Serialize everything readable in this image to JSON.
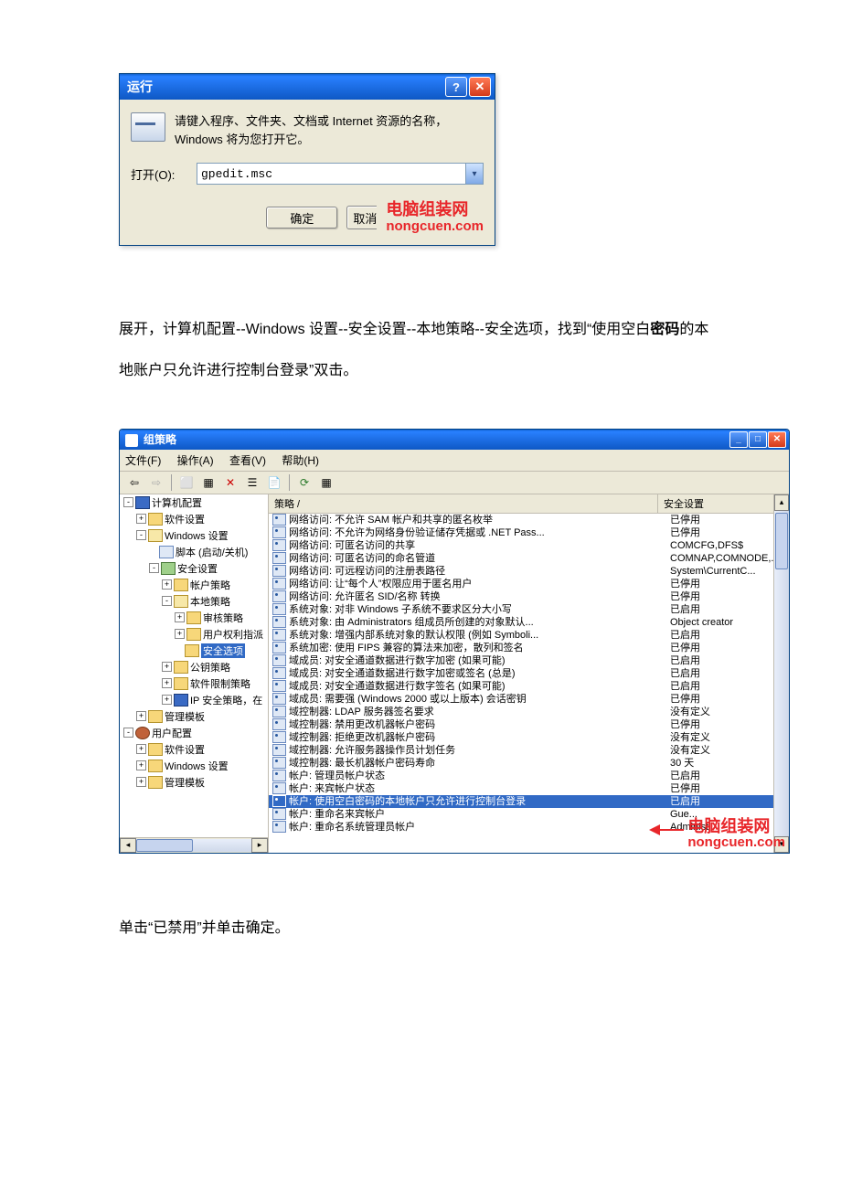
{
  "run_dialog": {
    "title": "运行",
    "description": "请键入程序、文件夹、文档或 Internet 资源的名称，Windows 将为您打开它。",
    "open_label": "打开(O):",
    "input_value": "gpedit.msc",
    "ok": "确定",
    "cancel_prefix": "取消"
  },
  "watermark": {
    "title": "电脑组装网",
    "url": "nongcuen.com"
  },
  "doc": {
    "para1_a": "展开，计算机配置--Windows 设置--安全设置--本地策略--安全选项，找到“使用空白",
    "para1_bold": "密码",
    "para1_b": "的本地账户只允许进行控制台登录”双击。",
    "para2": "单击“已禁用”并单击确定。"
  },
  "gp": {
    "title": "组策略",
    "menu": {
      "file": "文件(F)",
      "action": "操作(A)",
      "view": "查看(V)",
      "help": "帮助(H)"
    },
    "header_policy": "策略  /",
    "header_setting": "安全设置",
    "tree": [
      {
        "depth": 0,
        "exp": "-",
        "icon": "comp",
        "label": "计算机配置"
      },
      {
        "depth": 1,
        "exp": "+",
        "icon": "folder",
        "label": "软件设置"
      },
      {
        "depth": 1,
        "exp": "-",
        "icon": "folder-open",
        "label": "Windows 设置"
      },
      {
        "depth": 2,
        "exp": " ",
        "icon": "script",
        "label": "脚本 (启动/关机)"
      },
      {
        "depth": 2,
        "exp": "-",
        "icon": "sec",
        "label": "安全设置"
      },
      {
        "depth": 3,
        "exp": "+",
        "icon": "folder",
        "label": "帐户策略"
      },
      {
        "depth": 3,
        "exp": "-",
        "icon": "folder-open",
        "label": "本地策略"
      },
      {
        "depth": 4,
        "exp": "+",
        "icon": "folder",
        "label": "审核策略"
      },
      {
        "depth": 4,
        "exp": "+",
        "icon": "folder",
        "label": "用户权利指派"
      },
      {
        "depth": 4,
        "exp": " ",
        "icon": "folder",
        "label": "安全选项",
        "sel": true
      },
      {
        "depth": 3,
        "exp": "+",
        "icon": "folder",
        "label": "公钥策略"
      },
      {
        "depth": 3,
        "exp": "+",
        "icon": "folder",
        "label": "软件限制策略"
      },
      {
        "depth": 3,
        "exp": "+",
        "icon": "comp",
        "label": "IP 安全策略，在"
      },
      {
        "depth": 1,
        "exp": "+",
        "icon": "folder",
        "label": "管理模板"
      },
      {
        "depth": 0,
        "exp": "-",
        "icon": "user",
        "label": "用户配置"
      },
      {
        "depth": 1,
        "exp": "+",
        "icon": "folder",
        "label": "软件设置"
      },
      {
        "depth": 1,
        "exp": "+",
        "icon": "folder",
        "label": "Windows 设置"
      },
      {
        "depth": 1,
        "exp": "+",
        "icon": "folder",
        "label": "管理模板"
      }
    ],
    "rows": [
      {
        "p": "网络访问: 不允许 SAM 帐户和共享的匿名枚举",
        "s": "已停用"
      },
      {
        "p": "网络访问: 不允许为网络身份验证储存凭据或 .NET Pass...",
        "s": "已停用"
      },
      {
        "p": "网络访问: 可匿名访问的共享",
        "s": "COMCFG,DFS$"
      },
      {
        "p": "网络访问: 可匿名访问的命名管道",
        "s": "COMNAP,COMNODE,..."
      },
      {
        "p": "网络访问: 可远程访问的注册表路径",
        "s": "System\\CurrentC..."
      },
      {
        "p": "网络访问: 让“每个人”权限应用于匿名用户",
        "s": "已停用"
      },
      {
        "p": "网络访问: 允许匿名 SID/名称 转换",
        "s": "已停用"
      },
      {
        "p": "系统对象: 对非 Windows 子系统不要求区分大小写",
        "s": "已启用"
      },
      {
        "p": "系统对象: 由 Administrators 组成员所创建的对象默认...",
        "s": "Object creator"
      },
      {
        "p": "系统对象: 增强内部系统对象的默认权限 (例如 Symboli...",
        "s": "已启用"
      },
      {
        "p": "系统加密: 使用 FIPS 兼容的算法来加密，散列和签名",
        "s": "已停用"
      },
      {
        "p": "域成员: 对安全通道数据进行数字加密 (如果可能)",
        "s": "已启用"
      },
      {
        "p": "域成员: 对安全通道数据进行数字加密或签名 (总是)",
        "s": "已启用"
      },
      {
        "p": "域成员: 对安全通道数据进行数字签名 (如果可能)",
        "s": "已启用"
      },
      {
        "p": "域成员: 需要强 (Windows 2000 或以上版本) 会话密钥",
        "s": "已停用"
      },
      {
        "p": "域控制器: LDAP 服务器签名要求",
        "s": "没有定义"
      },
      {
        "p": "域控制器: 禁用更改机器帐户密码",
        "s": "已停用"
      },
      {
        "p": "域控制器: 拒绝更改机器帐户密码",
        "s": "没有定义"
      },
      {
        "p": "域控制器: 允许服务器操作员计划任务",
        "s": "没有定义"
      },
      {
        "p": "域控制器: 最长机器帐户密码寿命",
        "s": "30 天"
      },
      {
        "p": "帐户: 管理员帐户状态",
        "s": "已启用"
      },
      {
        "p": "帐户: 来宾帐户状态",
        "s": "已停用"
      },
      {
        "p": "帐户: 使用空白密码的本地帐户只允许进行控制台登录",
        "s": "已启用",
        "selected": true
      },
      {
        "p": "帐户: 重命名来宾帐户",
        "s": "Gue..."
      },
      {
        "p": "帐户: 重命名系统管理员帐户",
        "s": "Administ"
      }
    ]
  }
}
